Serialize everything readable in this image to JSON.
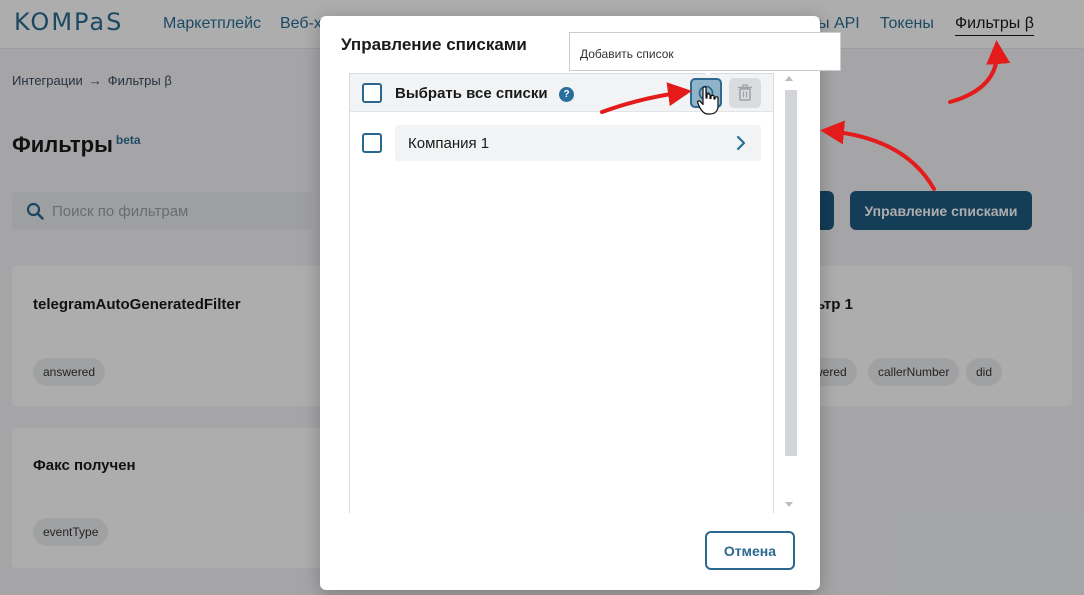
{
  "brand": {
    "logo_text": "KOMPaS",
    "accent": "#2a6890"
  },
  "nav": {
    "items": [
      "Маркетплейс",
      "Веб-х",
      "ы API",
      "Токены"
    ],
    "active": "Фильтры β"
  },
  "breadcrumb": {
    "root": "Интеграции",
    "separator": "→",
    "current": "Фильтры β"
  },
  "page": {
    "title": "Фильтры",
    "title_badge": "beta",
    "search_placeholder": "Поиск по фильтрам",
    "search_icon": "search-icon",
    "manage_lists_button": "Управление списками"
  },
  "cards": [
    {
      "title": "telegramAutoGeneratedFilter",
      "tags": [
        "answered"
      ]
    },
    {
      "title": "Факс получен",
      "tags": [
        "eventType"
      ]
    },
    {
      "title": "ьтр 1",
      "tags": [
        "wered",
        "callerNumber",
        "did"
      ]
    }
  ],
  "modal": {
    "title": "Управление списками",
    "select_all_label": "Выбрать все списки",
    "help_icon_text": "?",
    "add_icon": "plus-circle-icon",
    "delete_icon": "trash-icon",
    "lists": [
      {
        "name": "Компания 1",
        "chevron": "chevron-right-icon"
      }
    ],
    "cancel_label": "Отмена"
  },
  "tooltip": {
    "text": "Добавить список"
  },
  "annotation": {
    "arrow_color": "#e31b1b"
  }
}
